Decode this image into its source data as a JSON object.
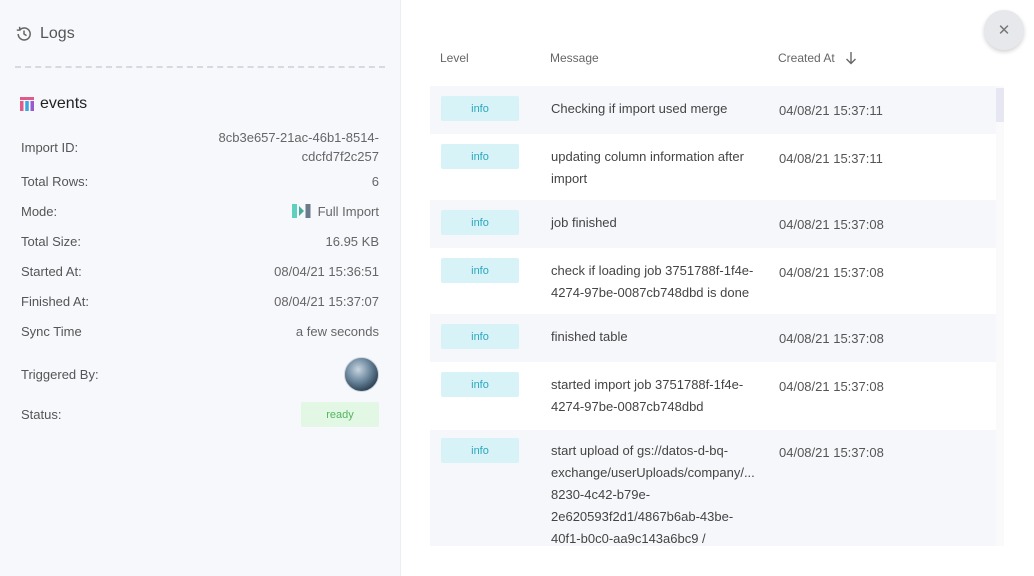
{
  "sidebar": {
    "title": "Logs",
    "entity_name": "events",
    "details": [
      {
        "label": "Import ID:",
        "value_lines": [
          "8cb3e657-21ac-46b1-8514-",
          "cdcfd7f2c257"
        ]
      },
      {
        "label": "Total Rows:",
        "value": "6"
      },
      {
        "label": "Mode:",
        "value": "Full Import"
      },
      {
        "label": "Total Size:",
        "value": "16.95 KB"
      },
      {
        "label": "Started At:",
        "value": "08/04/21 15:36:51"
      },
      {
        "label": "Finished At:",
        "value": "08/04/21 15:37:07"
      },
      {
        "label": "Sync Time",
        "value": "a few seconds"
      },
      {
        "label": "Triggered By:"
      },
      {
        "label": "Status:",
        "value": "ready"
      }
    ]
  },
  "table": {
    "columns": [
      "Level",
      "Message",
      "Created At"
    ],
    "rows": [
      {
        "level": "info",
        "message_lines": [
          "Checking if import used merge"
        ],
        "created_at": "04/08/21 15:37:11"
      },
      {
        "level": "info",
        "message_lines": [
          "updating column information after",
          "import"
        ],
        "created_at": "04/08/21 15:37:11"
      },
      {
        "level": "info",
        "message_lines": [
          "job finished"
        ],
        "created_at": "04/08/21 15:37:08"
      },
      {
        "level": "info",
        "message_lines": [
          "check if loading job 3751788f-1f4e-",
          "4274-97be-0087cb748dbd is done"
        ],
        "created_at": "04/08/21 15:37:08"
      },
      {
        "level": "info",
        "message_lines": [
          "finished table"
        ],
        "created_at": "04/08/21 15:37:08"
      },
      {
        "level": "info",
        "message_lines": [
          "started import job 3751788f-1f4e-",
          "4274-97be-0087cb748dbd"
        ],
        "created_at": "04/08/21 15:37:08"
      },
      {
        "level": "info",
        "message_lines": [
          "start upload of gs://datos-d-bq-",
          "exchange/userUploads/company/...",
          "8230-4c42-b79e-",
          "2e620593f2d1/4867b6ab-43be-",
          "40f1-b0c0-aa9c143a6bc9 /"
        ],
        "created_at": "04/08/21 15:37:08"
      }
    ]
  },
  "icons": {
    "history": "history-icon",
    "table": "table-icon",
    "full_import": "full-import-icon",
    "sort": "arrow-down-icon",
    "close": "close-icon"
  },
  "colors": {
    "info_badge_bg": "#d8f3f8",
    "info_badge_text": "#2ba6bd",
    "ready_badge_bg": "#e3f7e5",
    "ready_badge_text": "#52b660"
  }
}
